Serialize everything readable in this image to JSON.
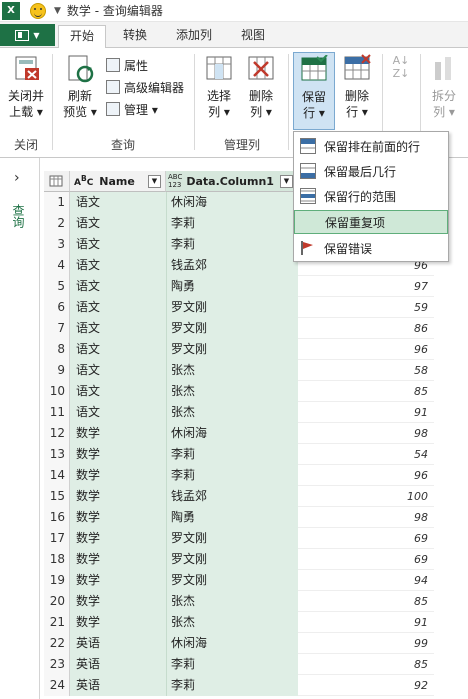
{
  "titlebar": {
    "excel_badge": "X",
    "title": "数学 - 查询编辑器"
  },
  "tabs": [
    {
      "label": "开始"
    },
    {
      "label": "转换"
    },
    {
      "label": "添加列"
    },
    {
      "label": "视图"
    }
  ],
  "ribbon": {
    "close_load": "关闭并\n上载",
    "close_load_1": "关闭并",
    "close_load_2": "上载 ▾",
    "refresh_1": "刷新",
    "refresh_2": "预览 ▾",
    "properties": "属性",
    "advanced": "高级编辑器",
    "manage": "管理 ▾",
    "choose_col_1": "选择",
    "choose_col_2": "列 ▾",
    "remove_col_1": "删除",
    "remove_col_2": "列 ▾",
    "keep_rows_1": "保留",
    "keep_rows_2": "行 ▾",
    "remove_rows_1": "删除",
    "remove_rows_2": "行 ▾",
    "split_1": "拆分",
    "split_2": "列 ▾",
    "group_close": "关闭",
    "group_query": "查询",
    "group_manage_cols": "管理列"
  },
  "left_pane": {
    "label": "查询",
    "chevron": "›"
  },
  "grid": {
    "headers": [
      {
        "label": "Name",
        "type": "ABC"
      },
      {
        "label": "Data.Column1",
        "type": "ABC\n123"
      }
    ],
    "rows": [
      {
        "n": "1",
        "a": "语文",
        "b": "休闲海",
        "c": ""
      },
      {
        "n": "2",
        "a": "语文",
        "b": "李莉",
        "c": ""
      },
      {
        "n": "3",
        "a": "语文",
        "b": "李莉",
        "c": ""
      },
      {
        "n": "4",
        "a": "语文",
        "b": "钱孟郊",
        "c": "96"
      },
      {
        "n": "5",
        "a": "语文",
        "b": "陶勇",
        "c": "97"
      },
      {
        "n": "6",
        "a": "语文",
        "b": "罗文刚",
        "c": "59"
      },
      {
        "n": "7",
        "a": "语文",
        "b": "罗文刚",
        "c": "86"
      },
      {
        "n": "8",
        "a": "语文",
        "b": "罗文刚",
        "c": "96"
      },
      {
        "n": "9",
        "a": "语文",
        "b": "张杰",
        "c": "58"
      },
      {
        "n": "10",
        "a": "语文",
        "b": "张杰",
        "c": "85"
      },
      {
        "n": "11",
        "a": "语文",
        "b": "张杰",
        "c": "91"
      },
      {
        "n": "12",
        "a": "数学",
        "b": "休闲海",
        "c": "98"
      },
      {
        "n": "13",
        "a": "数学",
        "b": "李莉",
        "c": "54"
      },
      {
        "n": "14",
        "a": "数学",
        "b": "李莉",
        "c": "96"
      },
      {
        "n": "15",
        "a": "数学",
        "b": "钱孟郊",
        "c": "100"
      },
      {
        "n": "16",
        "a": "数学",
        "b": "陶勇",
        "c": "98"
      },
      {
        "n": "17",
        "a": "数学",
        "b": "罗文刚",
        "c": "69"
      },
      {
        "n": "18",
        "a": "数学",
        "b": "罗文刚",
        "c": "69"
      },
      {
        "n": "19",
        "a": "数学",
        "b": "罗文刚",
        "c": "94"
      },
      {
        "n": "20",
        "a": "数学",
        "b": "张杰",
        "c": "85"
      },
      {
        "n": "21",
        "a": "数学",
        "b": "张杰",
        "c": "91"
      },
      {
        "n": "22",
        "a": "英语",
        "b": "休闲海",
        "c": "99"
      },
      {
        "n": "23",
        "a": "英语",
        "b": "李莉",
        "c": "85"
      },
      {
        "n": "24",
        "a": "英语",
        "b": "李莉",
        "c": "92"
      }
    ]
  },
  "menu": [
    {
      "label": "保留排在前面的行"
    },
    {
      "label": "保留最后几行"
    },
    {
      "label": "保留行的范围"
    },
    {
      "label": "保留重复项"
    },
    {
      "label": "保留错误"
    }
  ],
  "colors": {
    "excel_green": "#1e7145",
    "highlight": "#cfe8d7",
    "column_fill": "#dfeee5"
  }
}
